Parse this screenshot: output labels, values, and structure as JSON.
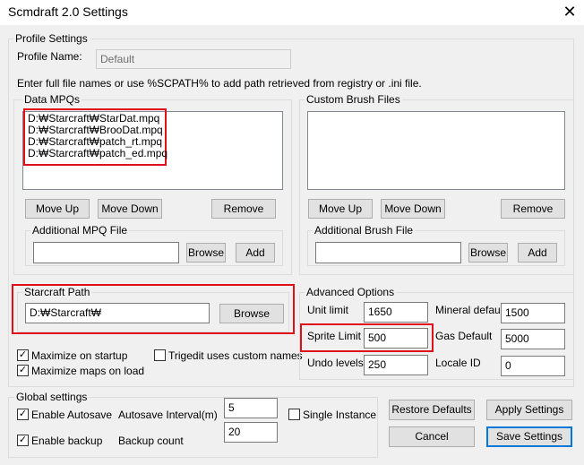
{
  "window": {
    "title": "Scmdraft 2.0 Settings",
    "close_glyph": "✕"
  },
  "profile": {
    "group_label": "Profile Settings",
    "name_label": "Profile Name:",
    "name_value": "Default",
    "hint": "Enter full file names or use %SCPATH% to add path retrieved from registry or .ini file."
  },
  "data_mpqs": {
    "group_label": "Data MPQs",
    "items": [
      "D:₩Starcraft₩StarDat.mpq",
      "D:₩Starcraft₩BrooDat.mpq",
      "D:₩Starcraft₩patch_rt.mpq",
      "D:₩Starcraft₩patch_ed.mpq"
    ],
    "move_up": "Move Up",
    "move_down": "Move Down",
    "remove": "Remove",
    "additional_label": "Additional MPQ File",
    "additional_value": "",
    "browse": "Browse",
    "add": "Add"
  },
  "custom_brush": {
    "group_label": "Custom Brush Files",
    "move_up": "Move Up",
    "move_down": "Move Down",
    "remove": "Remove",
    "additional_label": "Additional Brush File",
    "additional_value": "",
    "browse": "Browse",
    "add": "Add"
  },
  "starcraft_path": {
    "group_label": "Starcraft Path",
    "value": "D:₩Starcraft₩",
    "browse": "Browse"
  },
  "options": {
    "maximize_startup": "Maximize on startup",
    "maximize_maps": "Maximize maps on load",
    "trigedit_custom": "Trigedit uses custom names",
    "checkmark": "✓"
  },
  "advanced": {
    "group_label": "Advanced Options",
    "unit_limit_label": "Unit limit",
    "unit_limit_value": "1650",
    "sprite_limit_label": "Sprite Limit",
    "sprite_limit_value": "500",
    "undo_levels_label": "Undo levels",
    "undo_levels_value": "250",
    "mineral_default_label": "Mineral default",
    "mineral_default_value": "1500",
    "gas_default_label": "Gas Default",
    "gas_default_value": "5000",
    "locale_id_label": "Locale ID",
    "locale_id_value": "0"
  },
  "global": {
    "group_label": "Global settings",
    "enable_autosave": "Enable Autosave",
    "enable_backup": "Enable backup",
    "autosave_interval_label": "Autosave Interval(m)",
    "autosave_interval_value": "5",
    "backup_count_label": "Backup count",
    "backup_count_value": "20",
    "single_instance": "Single Instance"
  },
  "footer": {
    "restore_defaults": "Restore Defaults",
    "apply_settings": "Apply Settings",
    "cancel": "Cancel",
    "save_settings": "Save Settings"
  },
  "colors": {
    "highlight_red": "#e0101a",
    "focus_blue": "#0078d7",
    "window_bg": "#f0f0f0"
  }
}
